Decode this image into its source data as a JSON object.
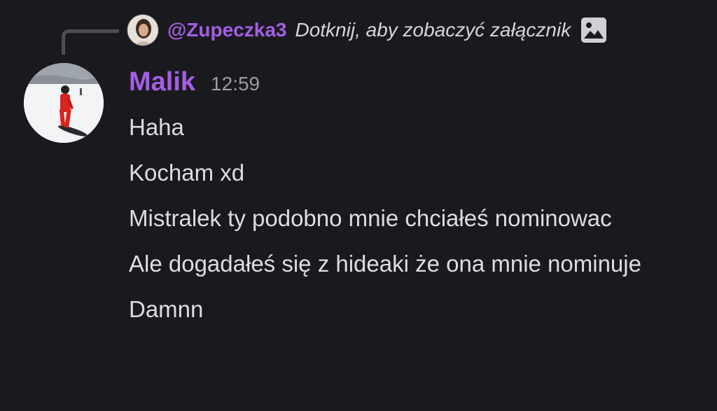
{
  "colors": {
    "background": "#1a1a1e",
    "username_purple": "#a45ee5",
    "text": "#dcdde1",
    "muted": "#9a9ba3",
    "spine": "#4d4e55"
  },
  "reply": {
    "username": "@Zupeczka3",
    "text": "Dotknij, aby zobaczyć załącznik",
    "attachment_icon": "image-icon"
  },
  "message": {
    "author": "Malik",
    "time": "12:59",
    "lines": [
      "Haha",
      "Kocham xd",
      "Mistralek ty podobno mnie chciałeś nominowac",
      "Ale dogadałeś się z hideaki że ona mnie nominuje",
      "Damnn"
    ]
  }
}
